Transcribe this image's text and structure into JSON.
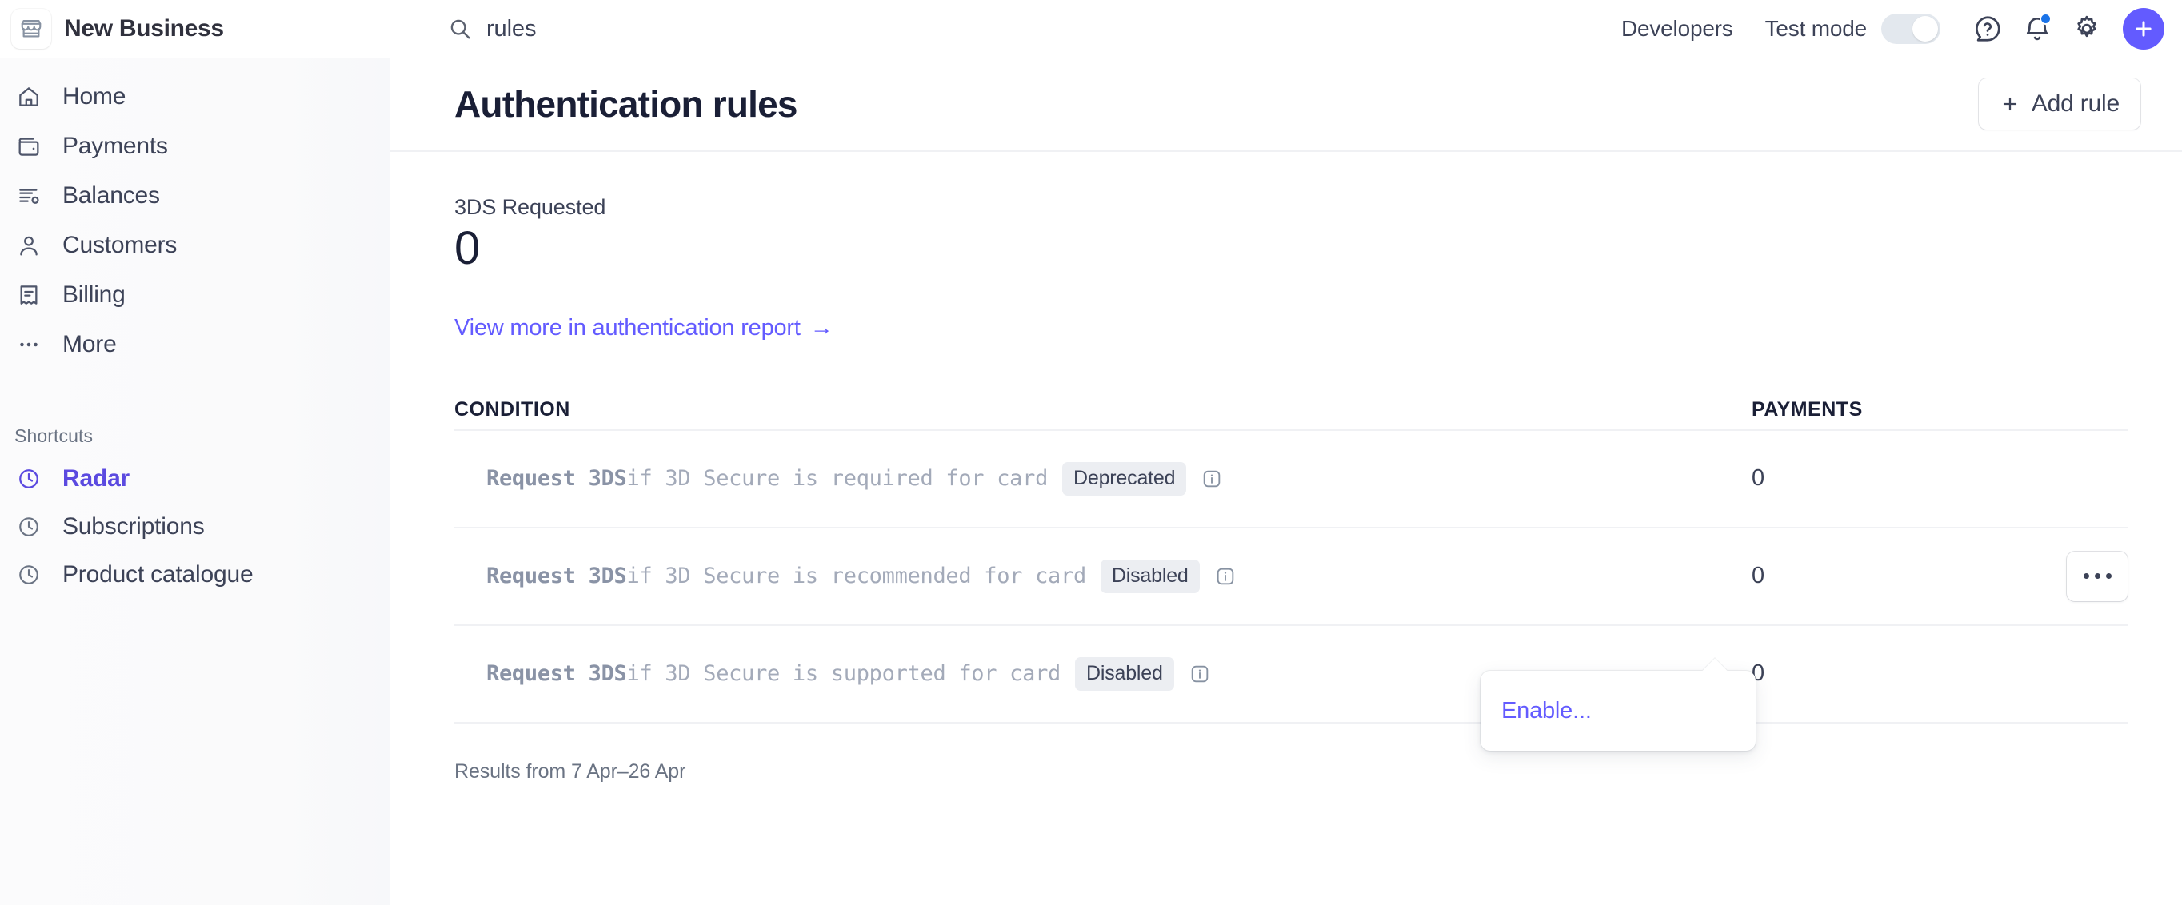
{
  "topbar": {
    "brand_icon": "storefront-icon",
    "brand_name": "New Business",
    "search": {
      "icon": "search-icon",
      "value": "rules",
      "placeholder": "Search"
    },
    "developers_label": "Developers",
    "test_mode_label": "Test mode",
    "test_mode_on": false,
    "icons": [
      "help-circle-icon",
      "bell-icon",
      "gear-icon",
      "plus-icon"
    ],
    "notification_dot_color": "#1a73e8",
    "plus_button_color": "#635bff"
  },
  "sidebar": {
    "items": [
      {
        "label": "Home",
        "icon": "home-icon"
      },
      {
        "label": "Payments",
        "icon": "wallet-icon"
      },
      {
        "label": "Balances",
        "icon": "balances-icon"
      },
      {
        "label": "Customers",
        "icon": "person-icon"
      },
      {
        "label": "Billing",
        "icon": "receipt-icon"
      },
      {
        "label": "More",
        "icon": "ellipsis-icon"
      }
    ],
    "shortcuts_title": "Shortcuts",
    "shortcuts": [
      {
        "label": "Radar",
        "icon": "clock-icon",
        "active": true
      },
      {
        "label": "Subscriptions",
        "icon": "clock-icon",
        "active": false
      },
      {
        "label": "Product catalogue",
        "icon": "clock-icon",
        "active": false
      }
    ],
    "active_color": "#5b4ae0"
  },
  "main": {
    "title": "Authentication rules",
    "add_rule_label": "Add rule",
    "add_rule_icon": "plus-icon",
    "metric": {
      "label": "3DS Requested",
      "value": "0",
      "link_text": "View more in authentication report",
      "link_arrow": "→",
      "link_color": "#635bff"
    },
    "table": {
      "columns": {
        "condition": "CONDITION",
        "payments": "PAYMENTS"
      },
      "rows": [
        {
          "rule_prefix": "Request 3DS",
          "rule_rest": " if 3D Secure is required for card",
          "badge": "Deprecated",
          "info_icon": "info-icon",
          "payments": "0",
          "has_menu_button": false
        },
        {
          "rule_prefix": "Request 3DS",
          "rule_rest": " if 3D Secure is recommended for card",
          "badge": "Disabled",
          "info_icon": "info-icon",
          "payments": "0",
          "has_menu_button": true,
          "menu_icon": "ellipsis-icon"
        },
        {
          "rule_prefix": "Request 3DS",
          "rule_rest": " if 3D Secure is supported for card",
          "badge": "Disabled",
          "info_icon": "info-icon",
          "payments": "0",
          "has_menu_button": false
        }
      ]
    },
    "popup_menu": {
      "items": [
        "Enable..."
      ],
      "color": "#635bff"
    },
    "results_note": "Results from 7 Apr–26 Apr"
  }
}
